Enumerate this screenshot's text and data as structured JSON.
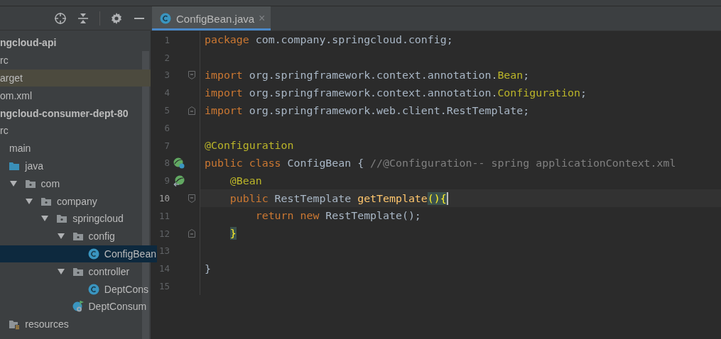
{
  "project_tree": [
    {
      "label": "ngcloud-api",
      "kind": "module",
      "selected": false,
      "hovered": false,
      "children": [
        {
          "label": "rc",
          "selected": false,
          "hovered": false
        },
        {
          "label": "arget",
          "selected": false,
          "hovered": true
        },
        {
          "label": "om.xml",
          "selected": false,
          "hovered": false
        }
      ]
    },
    {
      "label": "ngcloud-consumer-dept-80",
      "kind": "module",
      "selected": false,
      "hovered": false,
      "children": [
        {
          "label": "rc",
          "selected": false,
          "hovered": false,
          "children": [
            {
              "label": "main",
              "selected": false,
              "hovered": false,
              "children": [
                {
                  "label": "java",
                  "kind": "source-root",
                  "selected": false,
                  "hovered": false,
                  "children": [
                    {
                      "label": "com",
                      "kind": "package",
                      "expanded": true,
                      "selected": false,
                      "hovered": false,
                      "children": [
                        {
                          "label": "company",
                          "kind": "package",
                          "expanded": true,
                          "selected": false,
                          "hovered": false,
                          "children": [
                            {
                              "label": "springcloud",
                              "kind": "package",
                              "expanded": true,
                              "selected": false,
                              "hovered": false,
                              "children": [
                                {
                                  "label": "config",
                                  "kind": "package",
                                  "expanded": true,
                                  "selected": false,
                                  "hovered": false,
                                  "children": [
                                    {
                                      "label": "ConfigBean",
                                      "kind": "class",
                                      "selected": true,
                                      "hovered": false
                                    }
                                  ]
                                },
                                {
                                  "label": "controller",
                                  "kind": "package",
                                  "expanded": true,
                                  "selected": false,
                                  "hovered": false,
                                  "children": [
                                    {
                                      "label": "DeptCons",
                                      "kind": "class",
                                      "selected": false,
                                      "hovered": false
                                    }
                                  ]
                                },
                                {
                                  "label": "DeptConsum",
                                  "kind": "boot-class",
                                  "selected": false,
                                  "hovered": false
                                }
                              ]
                            }
                          ]
                        }
                      ]
                    }
                  ]
                },
                {
                  "label": "resources",
                  "kind": "resources-root",
                  "selected": false,
                  "hovered": false
                }
              ]
            }
          ]
        }
      ]
    }
  ],
  "editor": {
    "tabs": [
      {
        "label": "ConfigBean.java",
        "close": "×",
        "selected": true
      }
    ],
    "lines": [
      {
        "number": "1",
        "current": false,
        "tokens": [
          {
            "kind": "keyword",
            "text": "package"
          },
          {
            "kind": "plain",
            "text": " com.company.springcloud.config;"
          }
        ]
      },
      {
        "number": "2",
        "current": false
      },
      {
        "number": "3",
        "current": false,
        "fold": {
          "kind": "start"
        },
        "tokens": [
          {
            "kind": "keyword",
            "text": "import"
          },
          {
            "kind": "plain",
            "text": " org.springframework.context.annotation."
          },
          {
            "kind": "annotation",
            "text": "Bean"
          },
          {
            "kind": "plain",
            "text": ";"
          }
        ]
      },
      {
        "number": "4",
        "current": false,
        "tokens": [
          {
            "kind": "keyword",
            "text": "import"
          },
          {
            "kind": "plain",
            "text": " org.springframework.context.annotation."
          },
          {
            "kind": "annotation",
            "text": "Configuration"
          },
          {
            "kind": "plain",
            "text": ";"
          }
        ]
      },
      {
        "number": "5",
        "current": false,
        "fold": {
          "kind": "end"
        },
        "tokens": [
          {
            "kind": "keyword",
            "text": "import"
          },
          {
            "kind": "plain",
            "text": " org.springframework.web.client.RestTemplate;"
          }
        ]
      },
      {
        "number": "6",
        "current": false
      },
      {
        "number": "7",
        "current": false,
        "tokens": [
          {
            "kind": "annotation",
            "text": "@Configuration"
          }
        ]
      },
      {
        "number": "8",
        "current": false,
        "gutter": {
          "kind": "bean-class"
        },
        "tokens": [
          {
            "kind": "keyword",
            "text": "public class"
          },
          {
            "kind": "plain",
            "text": " ConfigBean { "
          },
          {
            "kind": "comment",
            "text": "//@Configuration-- spring applicationContext.xml"
          }
        ]
      },
      {
        "number": "9",
        "current": false,
        "gutter": {
          "kind": "bean-method"
        },
        "indent": {
          "kind": "one"
        },
        "tokens": [
          {
            "kind": "annotation",
            "text": "@Bean"
          }
        ]
      },
      {
        "number": "10",
        "current": true,
        "fold": {
          "kind": "start"
        },
        "indent": {
          "kind": "one"
        },
        "tokens": [
          {
            "kind": "keyword",
            "text": "public"
          },
          {
            "kind": "plain",
            "text": " RestTemplate "
          },
          {
            "kind": "method",
            "text": "getTemplate"
          },
          {
            "kind": "brace-match",
            "text": "(){"
          }
        ]
      },
      {
        "number": "11",
        "current": false,
        "indent": {
          "kind": "two"
        },
        "tokens": [
          {
            "kind": "keyword",
            "text": "return new"
          },
          {
            "kind": "plain",
            "text": " RestTemplate();"
          }
        ]
      },
      {
        "number": "12",
        "current": false,
        "fold": {
          "kind": "end"
        },
        "indent": {
          "kind": "one"
        },
        "tokens": [
          {
            "kind": "brace-match",
            "text": "}"
          }
        ]
      },
      {
        "number": "13",
        "current": false
      },
      {
        "number": "14",
        "current": false,
        "tokens": [
          {
            "kind": "plain",
            "text": "}"
          }
        ]
      },
      {
        "number": "15",
        "current": false
      }
    ]
  }
}
